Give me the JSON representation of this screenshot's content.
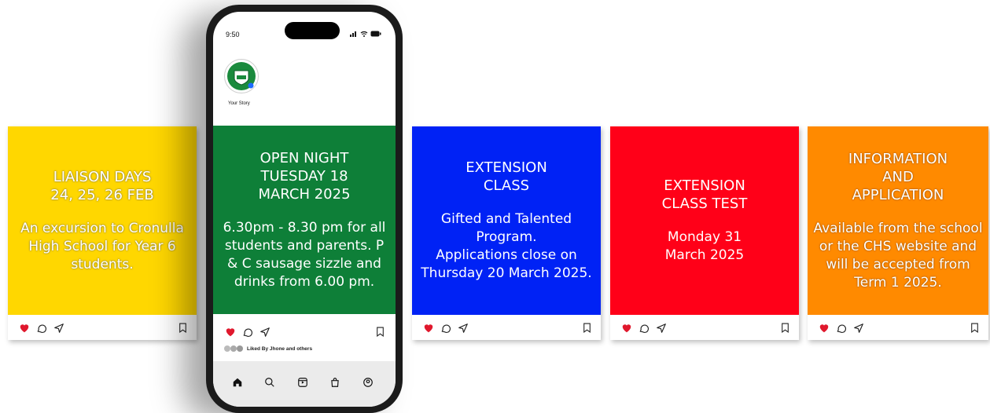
{
  "phone": {
    "time": "9:50",
    "status_icons": "signal wifi battery",
    "story_label": "Your Story",
    "liked_by": "Liked By Jhone and others"
  },
  "cards": [
    {
      "id": "liaison",
      "color": "#FFD700",
      "head": "LIAISON DAYS\n24, 25, 26 FEB",
      "body": "An excursion to Cronulla High School for Year 6 students."
    },
    {
      "id": "open-night",
      "color": "#0E7F38",
      "head": "OPEN NIGHT\nTUESDAY 18\nMARCH 2025",
      "body": "6.30pm - 8.30 pm for all students and parents. P & C sausage sizzle and drinks from 6.00 pm."
    },
    {
      "id": "extension-class",
      "color": "#0022F5",
      "head": "EXTENSION\nCLASS",
      "body": "Gifted and Talented Program.\nApplications close on Thursday 20 March 2025."
    },
    {
      "id": "extension-test",
      "color": "#FF0018",
      "head": "EXTENSION\nCLASS TEST",
      "body": "Monday 31\nMarch 2025"
    },
    {
      "id": "information",
      "color": "#FF8A00",
      "head": "INFORMATION\nAND\nAPPLICATION",
      "body": "Available from the school or the CHS website and will be accepted from Term 1 2025."
    }
  ],
  "icons": {
    "like": "heart-icon",
    "comment": "comment-icon",
    "share": "send-icon",
    "save": "bookmark-icon"
  },
  "nav_icons": [
    "home-icon",
    "search-icon",
    "reels-icon",
    "shop-icon",
    "profile-icon"
  ]
}
